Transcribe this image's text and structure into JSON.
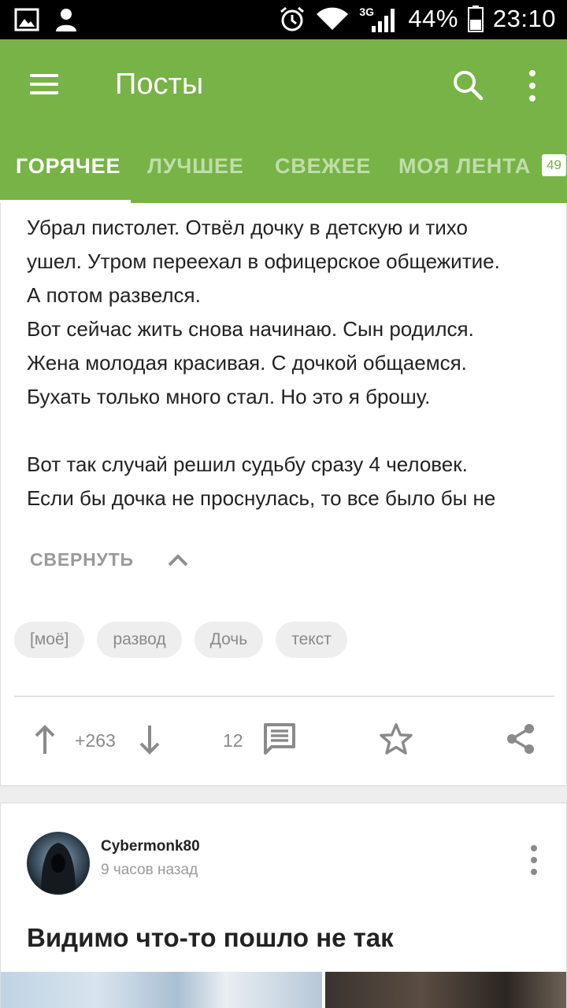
{
  "status_bar": {
    "battery": "44%",
    "time": "23:10",
    "network": "3G",
    "icons": [
      "gallery-icon",
      "person-icon",
      "alarm-icon",
      "wifi-icon",
      "signal-icon",
      "battery-icon"
    ]
  },
  "app_bar": {
    "title": "Посты",
    "background": "#77b346"
  },
  "tabs": [
    {
      "label": "ГОРЯЧЕЕ",
      "active": true
    },
    {
      "label": "ЛУЧШЕЕ",
      "active": false
    },
    {
      "label": "СВЕЖЕЕ",
      "active": false
    },
    {
      "label": "МОЯ ЛЕНТА",
      "active": false
    }
  ],
  "tab_badge": "49",
  "post1": {
    "lines": [
      "Убрал пистолет. Отвёл дочку в детскую и тихо",
      "ушел. Утром переехал в офицерское общежитие.",
      "А потом развелся.",
      "Вот сейчас жить снова начинаю. Сын родился.",
      "Жена молодая красивая. С дочкой общаемся.",
      "Бухать только много стал. Но это я брошу.",
      "",
      "Вот так случай решил судьбу сразу 4 человек.",
      "Если бы дочка не проснулась, то все было бы не"
    ],
    "collapse_label": "СВЕРНУТЬ",
    "tags": [
      "[моё]",
      "развод",
      "Дочь",
      "текст"
    ],
    "rating": "+263",
    "comments": "12"
  },
  "post2": {
    "author": "Cybermonk80",
    "time": "9 часов назад",
    "title": "Видимо что-то пошло не так"
  }
}
